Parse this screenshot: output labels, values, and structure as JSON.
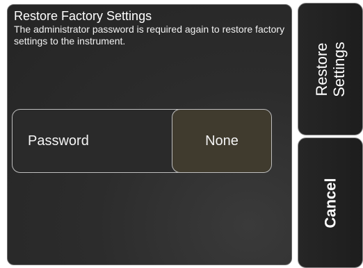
{
  "dialog": {
    "title": "Restore Factory Settings",
    "message": "The administrator password is required again to restore factory settings to the instrument."
  },
  "password_field": {
    "label": "Password",
    "value": "None"
  },
  "buttons": {
    "restore": "Restore\nSettings",
    "cancel": "Cancel"
  },
  "colors": {
    "panel_background": "#2c2c2c",
    "value_button_background": "#403b2e",
    "border": "#bfbfbf",
    "text": "#ffffff"
  }
}
